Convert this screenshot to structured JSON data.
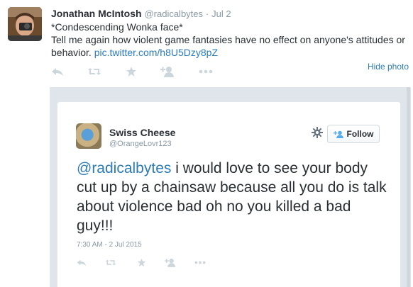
{
  "tweet": {
    "author_name": "Jonathan McIntosh",
    "author_handle": "@radicalbytes",
    "separator": "·",
    "date": "Jul 2",
    "line1": "*Condescending Wonka face*",
    "line2": "Tell me again how violent game fantasies have no effect on anyone's attitudes or behavior.",
    "link": "pic.twitter.com/h8U5Dzy8pZ",
    "hide_photo": "Hide photo",
    "actions": [
      "reply-icon",
      "retweet-icon",
      "favorite-icon",
      "follow-icon",
      "more-icon"
    ]
  },
  "embedded": {
    "name": "Swiss Cheese",
    "handle": "@OrangeLovr123",
    "follow_label": "Follow",
    "mention": "@radicalbytes",
    "text": " i would love to see your body cut up by a chainsaw because all you do is talk about violence bad oh no you killed a bad guy!!!",
    "timestamp": "7:30 AM - 2 Jul 2015"
  },
  "colors": {
    "link": "#2b7bb9",
    "muted": "#8899a6",
    "icon": "#ccd6dd"
  }
}
